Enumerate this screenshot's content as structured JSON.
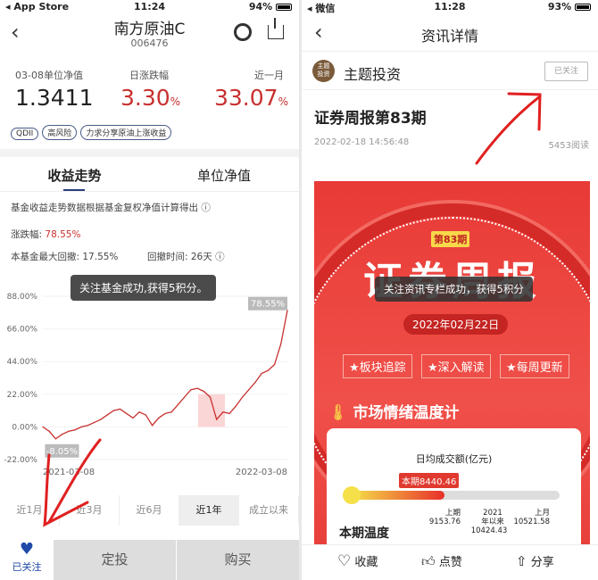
{
  "left": {
    "status": {
      "carrier": "◂ App Store",
      "time": "11:24",
      "battery": "94%",
      "battery_level": 0.94
    },
    "header": {
      "title": "南方原油C",
      "code": "006476"
    },
    "stats": [
      {
        "label": "03-08单位净值",
        "value": "1.3411",
        "unit": ""
      },
      {
        "label": "日涨跌幅",
        "value": "3.30",
        "unit": "%"
      },
      {
        "label": "近一月",
        "value": "33.07",
        "unit": "%"
      }
    ],
    "tags": [
      "QDII",
      "高风险",
      "力求分享原油上涨收益"
    ],
    "tabs": [
      "收益走势",
      "单位净值"
    ],
    "note": "基金收益走势数据根据基金复权净值计算得出",
    "change_label": "涨跌幅:",
    "change_value": "78.55%",
    "drawdown_label": "本基金最大回撤: 17.55%",
    "drawdown_time": "回撤时间: 26天",
    "toast": "关注基金成功,获得5积分。",
    "ranges": [
      "近1月",
      "近3月",
      "近6月",
      "近1年",
      "成立以来"
    ],
    "active_range": 3,
    "bottom": {
      "follow": "已关注",
      "plan": "定投",
      "buy": "购买"
    }
  },
  "chart_data": {
    "type": "line",
    "ylim": [
      -22,
      88
    ],
    "yticks": [
      "88.00%",
      "66.00%",
      "44.00%",
      "22.00%",
      "0.00%",
      "-22.00%"
    ],
    "ytick_values": [
      88,
      66,
      44,
      22,
      0,
      -22
    ],
    "xticks": [
      "2021-03-08",
      "2022-03-08"
    ],
    "max_label": "78.55%",
    "min_label": "-8.05%",
    "grid": true,
    "series": [
      {
        "values": [
          0,
          -3,
          -8.05,
          -5,
          -3,
          -2,
          0,
          1,
          3,
          5,
          8,
          11,
          12,
          9,
          6,
          10,
          8,
          1,
          6,
          9,
          10,
          15,
          20,
          25,
          26,
          24,
          20,
          5,
          10,
          9,
          14,
          20,
          25,
          30,
          36,
          38,
          42,
          56,
          78.55
        ]
      }
    ],
    "line_color": "#c8302f"
  },
  "right": {
    "status": {
      "carrier": "◂ 微信",
      "time": "11:28",
      "battery": "93%",
      "battery_level": 0.93
    },
    "header": {
      "title": "资讯详情"
    },
    "author": {
      "avatar": "主题投资",
      "name": "主题投资",
      "follow": "已关注"
    },
    "article": {
      "title": "证券周报第83期",
      "date": "2022-02-18 14:56:48",
      "reads": "5453阅读"
    },
    "poster": {
      "issue": "第83期",
      "title": "证券周报",
      "date": "2022年02月22日",
      "features": [
        "★板块追踪",
        "★深入解读",
        "★每周更新"
      ],
      "section": "市场情绪温度计",
      "card_title": "日均成交额(亿元)",
      "current": "本期8440.46",
      "current_fraction": 0.45,
      "marks": [
        {
          "label": "上期",
          "value": "9153.76"
        },
        {
          "label": "2021年以来",
          "value": "10424.43"
        },
        {
          "label": "上月",
          "value": "10521.58"
        }
      ],
      "next": "本期温度"
    },
    "toast": "关注资讯专栏成功，获得5积分",
    "bottom": {
      "fav": "收藏",
      "like": "点赞",
      "share": "分享"
    }
  }
}
